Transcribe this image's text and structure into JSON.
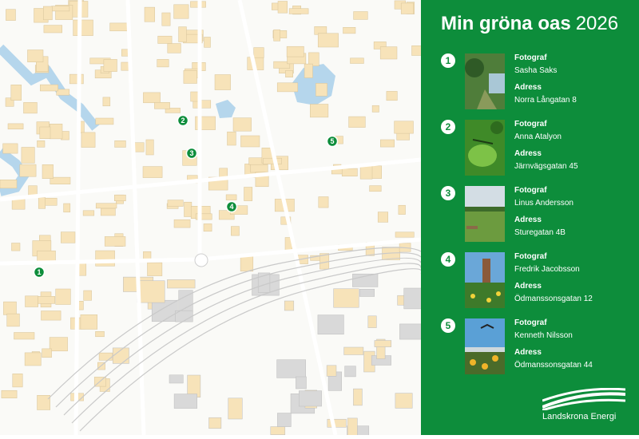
{
  "title": {
    "main": "Min gröna oas",
    "year": "2026"
  },
  "labels": {
    "photographer": "Fotograf",
    "address": "Adress"
  },
  "entries": [
    {
      "number": "1",
      "photographer": "Sasha Saks",
      "address": "Norra Långatan 8"
    },
    {
      "number": "2",
      "photographer": "Anna Atalyon",
      "address": "Järnvägsgatan 45"
    },
    {
      "number": "3",
      "photographer": "Linus Andersson",
      "address": "Sturegatan 4B"
    },
    {
      "number": "4",
      "photographer": "Fredrik Jacobsson",
      "address": "Ödmanssonsgatan 12"
    },
    {
      "number": "5",
      "photographer": "Kenneth Nilsson",
      "address": "Ödmanssonsgatan 44"
    }
  ],
  "logo": {
    "text": "Landskrona Energi"
  },
  "colors": {
    "accent": "#0d8d3b",
    "water": "#b5d6ec",
    "building": "#f7e3b9",
    "industrial": "#d9d9d9"
  }
}
